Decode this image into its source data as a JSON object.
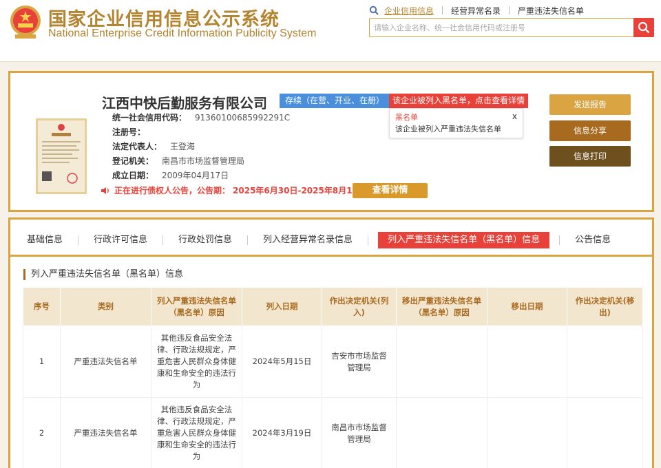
{
  "header": {
    "title_cn": "国家企业信用信息公示系统",
    "title_en": "National Enterprise Credit Information Publicity System",
    "nav_links": [
      "企业信用信息",
      "经营异常名录",
      "严重违法失信名单"
    ],
    "search_placeholder": "请输入企业名称、统一社会信用代码或注册号",
    "accent_color": "#b4842e"
  },
  "company": {
    "name": "江西中快后勤服务有限公司",
    "status": "存续（在营、开业、在册）",
    "blacklist_alert": "该企业被列入黑名单，点击查看详情",
    "tooltip_title": "黑名单",
    "tooltip_text": "该企业被列入严重违法失信名单",
    "tooltip_close": "x",
    "fields": [
      {
        "label": "统一社会信用代码：",
        "value": "91360100685992291C"
      },
      {
        "label": "注册号：",
        "value": ""
      },
      {
        "label": "法定代表人：",
        "value": "王登海"
      },
      {
        "label": "登记机关：",
        "value": "南昌市市场监督管理局"
      },
      {
        "label": "成立日期：",
        "value": "2009年04月17日"
      }
    ],
    "notice_text": "正在进行债权人公告，公告期：",
    "notice_period": "2025年6月30日-2025年8月14日",
    "detail_button": "查看详情",
    "license_icon": "business-license-image"
  },
  "side_buttons": {
    "report": "发送报告",
    "share": "信息分享",
    "print": "信息打印"
  },
  "tabs": [
    "基础信息",
    "行政许可信息",
    "行政处罚信息",
    "列入经营异常名录信息",
    "列入严重违法失信名单（黑名单）信息",
    "公告信息"
  ],
  "active_tab_index": 4,
  "section": {
    "title": "列入严重违法失信名单（黑名单）信息",
    "columns": [
      "序号",
      "类别",
      "列入严重违法失信名单（黑名单）原因",
      "列入日期",
      "作出决定机关(列入)",
      "移出严重违法失信名单（黑名单）原因",
      "移出日期",
      "作出决定机关(移出)"
    ],
    "rows": [
      {
        "no": "1",
        "category": "严重违法失信名单",
        "reason": "其他违反食品安全法律、行政法规规定，严重危害人民群众身体健康和生命安全的违法行为",
        "date": "2024年5月15日",
        "authority": "吉安市市场监督管理局",
        "remove_reason": "",
        "remove_date": "",
        "remove_authority": ""
      },
      {
        "no": "2",
        "category": "严重违法失信名单",
        "reason": "其他违反食品安全法律、行政法规规定，严重危害人民群众身体健康和生命安全的违法行为",
        "date": "2024年3月19日",
        "authority": "南昌市市场监督管理局",
        "remove_reason": "",
        "remove_date": "",
        "remove_authority": ""
      }
    ]
  }
}
